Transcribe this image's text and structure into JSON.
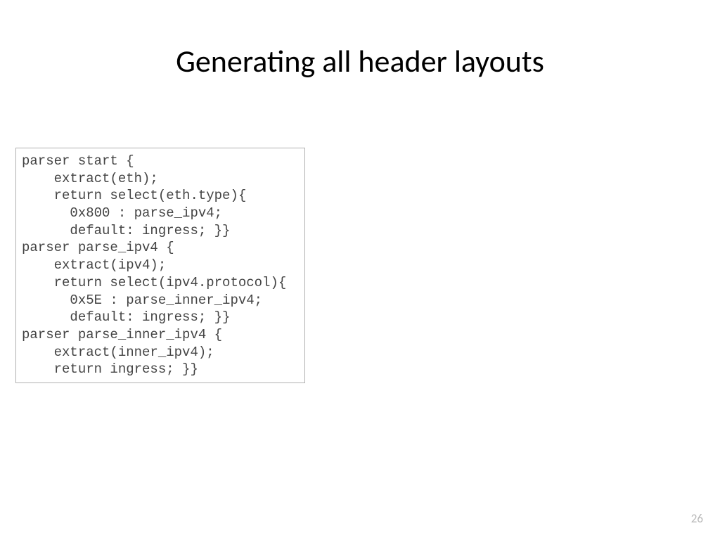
{
  "title": "Generating all header layouts",
  "code": "parser start {\n    extract(eth);\n    return select(eth.type){\n      0x800 : parse_ipv4;\n      default: ingress; }}\nparser parse_ipv4 {\n    extract(ipv4);\n    return select(ipv4.protocol){\n      0x5E : parse_inner_ipv4;\n      default: ingress; }}\nparser parse_inner_ipv4 {\n    extract(inner_ipv4);\n    return ingress; }}",
  "page_number": "26"
}
